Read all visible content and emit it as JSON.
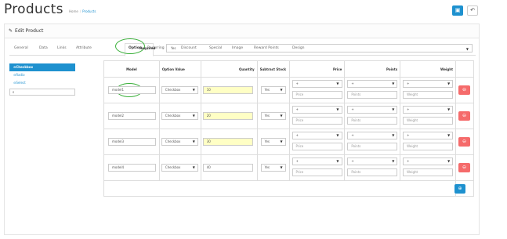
{
  "header": {
    "title": "Products",
    "breadcrumb": [
      "Home",
      "Products"
    ],
    "save_icon": "save-icon",
    "back_icon": "back-icon"
  },
  "panel": {
    "heading": "Edit Product",
    "tabs": [
      "General",
      "Data",
      "Links",
      "Attribute",
      "Option",
      "Recurring",
      "Discount",
      "Special",
      "Image",
      "Reward Points",
      "Design"
    ],
    "active_tab": "Option"
  },
  "sidebar": {
    "items": [
      "Checkbox",
      "Radio",
      "Select"
    ],
    "active": "Checkbox",
    "input_value": "s"
  },
  "required": {
    "label": "Required",
    "value": "Yes"
  },
  "table": {
    "headers": [
      "Model",
      "Option Value",
      "Quantity",
      "Subtract Stock",
      "Price",
      "Points",
      "Weight"
    ],
    "rows": [
      {
        "model": "model1",
        "option_value": "Checkbox",
        "quantity": "10",
        "subtract": "Yes",
        "price_sign": "+",
        "price_ph": "Price",
        "points_sign": "+",
        "points_ph": "Points",
        "weight_sign": "+",
        "weight_ph": "Weight",
        "highlight": true
      },
      {
        "model": "model2",
        "option_value": "Checkbox",
        "quantity": "20",
        "subtract": "Yes",
        "price_sign": "+",
        "price_ph": "Price",
        "points_sign": "+",
        "points_ph": "Points",
        "weight_sign": "+",
        "weight_ph": "Weight",
        "highlight": true
      },
      {
        "model": "model3",
        "option_value": "Checkbox",
        "quantity": "30",
        "subtract": "Yes",
        "price_sign": "+",
        "price_ph": "Price",
        "points_sign": "+",
        "points_ph": "Points",
        "weight_sign": "+",
        "weight_ph": "Weight",
        "highlight": true
      },
      {
        "model": "model4",
        "option_value": "Checkbox",
        "quantity": "40",
        "subtract": "Yes",
        "price_sign": "+",
        "price_ph": "Price",
        "points_sign": "+",
        "points_ph": "Points",
        "weight_sign": "+",
        "weight_ph": "Weight",
        "highlight": false
      }
    ]
  },
  "colors": {
    "primary": "#1e91cf",
    "danger": "#f56b6b",
    "highlight": "#ffffc5",
    "annotation": "#3ab03a"
  }
}
